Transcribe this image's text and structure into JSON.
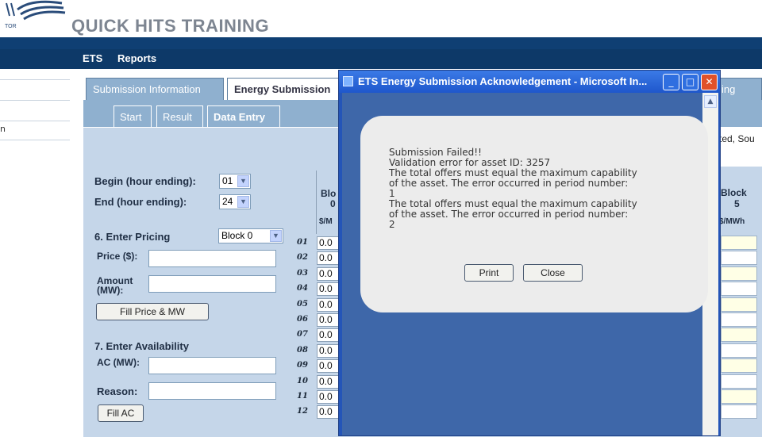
{
  "header": {
    "brand_fragment": "TOR",
    "title": "QUICK HITS TRAINING"
  },
  "menu": {
    "items": [
      "ETS",
      "Reports"
    ]
  },
  "leftnav": {
    "fragment": "n"
  },
  "tabs": {
    "outer": [
      "Submission Information",
      "Energy Submission",
      "ing"
    ],
    "inner": [
      "Start",
      "Result",
      "Data Entry"
    ]
  },
  "form": {
    "begin_label": "Begin (hour ending):",
    "begin_value": "01",
    "end_label": "End (hour ending):",
    "end_value": "24",
    "pricing_label": "6. Enter Pricing",
    "block_value": "Block 0",
    "price_label": "Price ($):",
    "amount_label": "Amount (MW):",
    "fill_price_button": "Fill Price & MW",
    "availability_label": "7. Enter Availability",
    "ac_label": "AC (MW):",
    "reason_label": "Reason:",
    "fill_ac_button": "Fill AC"
  },
  "grid": {
    "col_head_block": "Blo",
    "col_head_block_num": "0",
    "col_head_unit": "$/M",
    "rows": [
      {
        "n": "01",
        "v": "0.0"
      },
      {
        "n": "02",
        "v": "0.0"
      },
      {
        "n": "03",
        "v": "0.0"
      },
      {
        "n": "04",
        "v": "0.0"
      },
      {
        "n": "05",
        "v": "0.0"
      },
      {
        "n": "06",
        "v": "0.0"
      },
      {
        "n": "07",
        "v": "0.0"
      },
      {
        "n": "08",
        "v": "0.0"
      },
      {
        "n": "09",
        "v": "0.0"
      },
      {
        "n": "10",
        "v": "0.0"
      },
      {
        "n": "11",
        "v": "0.0"
      },
      {
        "n": "12",
        "v": "0.0"
      }
    ],
    "right_fragment": "ted, Sou",
    "right_block_label": "Block",
    "right_block_num": "5",
    "right_unit": "$/MWh"
  },
  "popup": {
    "title": "ETS Energy Submission Acknowledgement - Microsoft In...",
    "message": "Submission Failed!!\nValidation error for asset ID: 3257\nThe total offers must equal the maximum capability\nof the asset. The error occurred in period number:\n1\nThe total offers must equal the maximum capability\nof the asset. The error occurred in period number:\n2",
    "print_button": "Print",
    "close_button": "Close"
  },
  "colors": {
    "header_blue": "#0f3f73",
    "panel_blue": "#8fb0cf",
    "popup_blue": "#2455b8"
  }
}
